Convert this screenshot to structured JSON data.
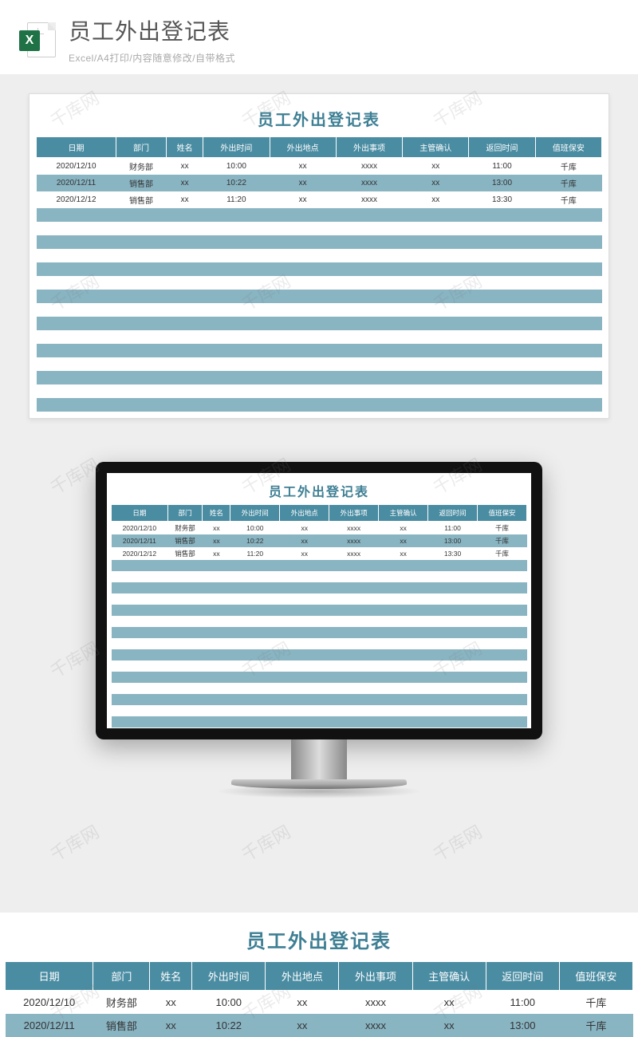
{
  "header": {
    "title": "员工外出登记表",
    "subtitle": "Excel/A4打印/内容随意修改/自带格式",
    "icon_letter": "X"
  },
  "sheet": {
    "title": "员工外出登记表",
    "columns": [
      "日期",
      "部门",
      "姓名",
      "外出时间",
      "外出地点",
      "外出事项",
      "主管确认",
      "返回时间",
      "值班保安"
    ],
    "rows": [
      {
        "date": "2020/12/10",
        "dept": "财务部",
        "name": "xx",
        "out_time": "10:00",
        "place": "xx",
        "matter": "xxxx",
        "approve": "xx",
        "return_time": "11:00",
        "guard": "千库"
      },
      {
        "date": "2020/12/11",
        "dept": "销售部",
        "name": "xx",
        "out_time": "10:22",
        "place": "xx",
        "matter": "xxxx",
        "approve": "xx",
        "return_time": "13:00",
        "guard": "千库"
      },
      {
        "date": "2020/12/12",
        "dept": "销售部",
        "name": "xx",
        "out_time": "11:20",
        "place": "xx",
        "matter": "xxxx",
        "approve": "xx",
        "return_time": "13:30",
        "guard": "千库"
      }
    ],
    "empty_row_count": 15
  },
  "bottom_preview": {
    "visible_rows": 2
  },
  "watermark": "千库网",
  "colors": {
    "header_bg": "#4a8ca2",
    "stripe": "#89b4c2",
    "title": "#3e7f94"
  }
}
